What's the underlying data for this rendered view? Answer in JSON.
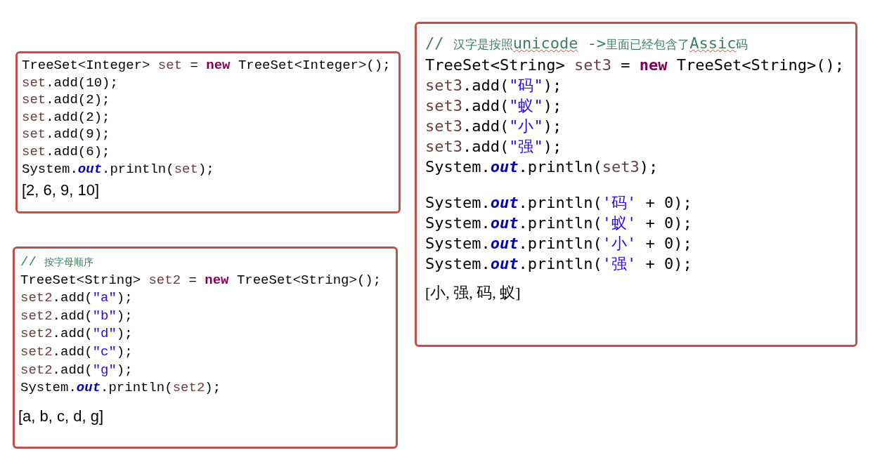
{
  "snippets": [
    {
      "lines": [
        [
          {
            "text": "TreeSet<Integer> ",
            "kind": "plain"
          },
          {
            "text": "set",
            "kind": "var"
          },
          {
            "text": " = ",
            "kind": "plain"
          },
          {
            "text": "new",
            "kind": "keyword"
          },
          {
            "text": " TreeSet<Integer>();",
            "kind": "plain"
          }
        ],
        [
          {
            "text": "set",
            "kind": "var"
          },
          {
            "text": ".add(10);",
            "kind": "plain"
          }
        ],
        [
          {
            "text": "set",
            "kind": "var"
          },
          {
            "text": ".add(2);",
            "kind": "plain"
          }
        ],
        [
          {
            "text": "set",
            "kind": "var"
          },
          {
            "text": ".add(2);",
            "kind": "plain"
          }
        ],
        [
          {
            "text": "set",
            "kind": "var"
          },
          {
            "text": ".add(9);",
            "kind": "plain"
          }
        ],
        [
          {
            "text": "set",
            "kind": "var"
          },
          {
            "text": ".add(6);",
            "kind": "plain"
          }
        ],
        [
          {
            "text": "System.",
            "kind": "plain"
          },
          {
            "text": "out",
            "kind": "field"
          },
          {
            "text": ".println(",
            "kind": "plain"
          },
          {
            "text": "set",
            "kind": "var"
          },
          {
            "text": ");",
            "kind": "plain"
          }
        ]
      ],
      "output": "[2, 6, 9, 10]"
    },
    {
      "lines": [
        [
          {
            "text": "// ",
            "kind": "comment"
          },
          {
            "text": "按字母顺序",
            "kind": "comment-cjk"
          }
        ],
        [
          {
            "text": "TreeSet<String> ",
            "kind": "plain"
          },
          {
            "text": "set2",
            "kind": "var"
          },
          {
            "text": " = ",
            "kind": "plain"
          },
          {
            "text": "new",
            "kind": "keyword"
          },
          {
            "text": " TreeSet<String>();",
            "kind": "plain"
          }
        ],
        [
          {
            "text": "set2",
            "kind": "var"
          },
          {
            "text": ".add(",
            "kind": "plain"
          },
          {
            "text": "\"a\"",
            "kind": "string"
          },
          {
            "text": ");",
            "kind": "plain"
          }
        ],
        [
          {
            "text": "set2",
            "kind": "var"
          },
          {
            "text": ".add(",
            "kind": "plain"
          },
          {
            "text": "\"b\"",
            "kind": "string"
          },
          {
            "text": ");",
            "kind": "plain"
          }
        ],
        [
          {
            "text": "set2",
            "kind": "var"
          },
          {
            "text": ".add(",
            "kind": "plain"
          },
          {
            "text": "\"d\"",
            "kind": "string"
          },
          {
            "text": ");",
            "kind": "plain"
          }
        ],
        [
          {
            "text": "set2",
            "kind": "var"
          },
          {
            "text": ".add(",
            "kind": "plain"
          },
          {
            "text": "\"c\"",
            "kind": "string"
          },
          {
            "text": ");",
            "kind": "plain"
          }
        ],
        [
          {
            "text": "set2",
            "kind": "var"
          },
          {
            "text": ".add(",
            "kind": "plain"
          },
          {
            "text": "\"g\"",
            "kind": "string"
          },
          {
            "text": ");",
            "kind": "plain"
          }
        ],
        [
          {
            "text": "System.",
            "kind": "plain"
          },
          {
            "text": "out",
            "kind": "field"
          },
          {
            "text": ".println(",
            "kind": "plain"
          },
          {
            "text": "set2",
            "kind": "var"
          },
          {
            "text": ");",
            "kind": "plain"
          }
        ]
      ],
      "output": "[a, b, c, d, g]"
    },
    {
      "lines": [
        [
          {
            "text": "// ",
            "kind": "comment"
          },
          {
            "text": "汉字是按照",
            "kind": "comment-cjk"
          },
          {
            "text": "unicode",
            "kind": "comment-misspelled"
          },
          {
            "text": " ->",
            "kind": "comment"
          },
          {
            "text": "里面已经包含了",
            "kind": "comment-cjk"
          },
          {
            "text": "Assic",
            "kind": "comment-misspelled"
          },
          {
            "text": "码",
            "kind": "comment-cjk"
          }
        ],
        [
          {
            "text": "TreeSet<String> ",
            "kind": "plain"
          },
          {
            "text": "set3",
            "kind": "var"
          },
          {
            "text": " = ",
            "kind": "plain"
          },
          {
            "text": "new",
            "kind": "keyword"
          },
          {
            "text": " TreeSet<String>();",
            "kind": "plain"
          }
        ],
        [
          {
            "text": "set3",
            "kind": "var"
          },
          {
            "text": ".add(",
            "kind": "plain"
          },
          {
            "text": "\"码\"",
            "kind": "string"
          },
          {
            "text": ");",
            "kind": "plain"
          }
        ],
        [
          {
            "text": "set3",
            "kind": "var"
          },
          {
            "text": ".add(",
            "kind": "plain"
          },
          {
            "text": "\"蚁\"",
            "kind": "string"
          },
          {
            "text": ");",
            "kind": "plain"
          }
        ],
        [
          {
            "text": "set3",
            "kind": "var"
          },
          {
            "text": ".add(",
            "kind": "plain"
          },
          {
            "text": "\"小\"",
            "kind": "string"
          },
          {
            "text": ");",
            "kind": "plain"
          }
        ],
        [
          {
            "text": "set3",
            "kind": "var"
          },
          {
            "text": ".add(",
            "kind": "plain"
          },
          {
            "text": "\"强\"",
            "kind": "string"
          },
          {
            "text": ");",
            "kind": "plain"
          }
        ],
        [
          {
            "text": "System.",
            "kind": "plain"
          },
          {
            "text": "out",
            "kind": "field"
          },
          {
            "text": ".println(",
            "kind": "plain"
          },
          {
            "text": "set3",
            "kind": "var"
          },
          {
            "text": ");",
            "kind": "plain"
          }
        ]
      ],
      "more_lines": [
        [
          {
            "text": "System.",
            "kind": "plain"
          },
          {
            "text": "out",
            "kind": "field"
          },
          {
            "text": ".println(",
            "kind": "plain"
          },
          {
            "text": "'码'",
            "kind": "string"
          },
          {
            "text": " + 0);",
            "kind": "plain"
          }
        ],
        [
          {
            "text": "System.",
            "kind": "plain"
          },
          {
            "text": "out",
            "kind": "field"
          },
          {
            "text": ".println(",
            "kind": "plain"
          },
          {
            "text": "'蚁'",
            "kind": "string"
          },
          {
            "text": " + 0);",
            "kind": "plain"
          }
        ],
        [
          {
            "text": "System.",
            "kind": "plain"
          },
          {
            "text": "out",
            "kind": "field"
          },
          {
            "text": ".println(",
            "kind": "plain"
          },
          {
            "text": "'小'",
            "kind": "string"
          },
          {
            "text": " + 0);",
            "kind": "plain"
          }
        ],
        [
          {
            "text": "System.",
            "kind": "plain"
          },
          {
            "text": "out",
            "kind": "field"
          },
          {
            "text": ".println(",
            "kind": "plain"
          },
          {
            "text": "'强'",
            "kind": "string"
          },
          {
            "text": " + 0);",
            "kind": "plain"
          }
        ]
      ],
      "output": "[小, 强, 码, 蚁]"
    }
  ]
}
